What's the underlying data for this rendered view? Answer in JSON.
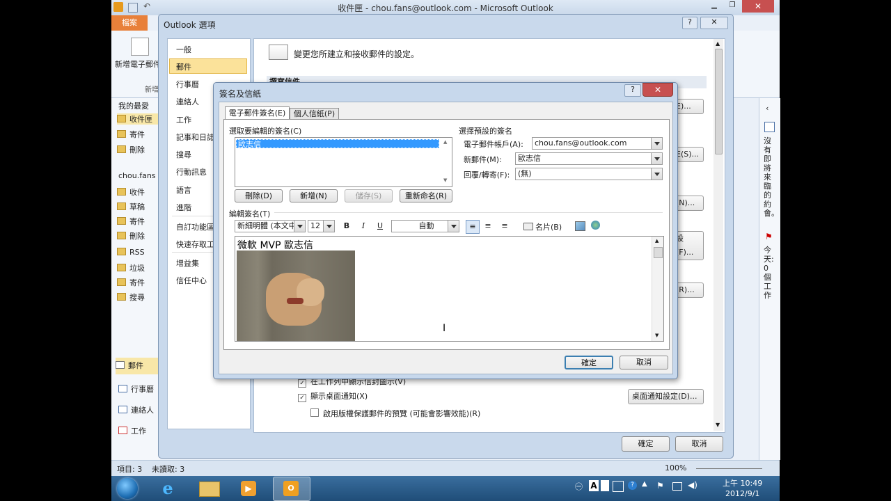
{
  "outlook": {
    "title": "收件匣 - chou.fans@outlook.com - Microsoft Outlook",
    "file_tab": "檔案",
    "new_email": "新增電子郵件",
    "new_group": "新增",
    "nav_favorites": "我的最愛",
    "nav_favorites_items": [
      "收件匣",
      "寄件",
      "刪除"
    ],
    "nav_account": "chou.fans",
    "nav_account_items": [
      "收件",
      "草稿",
      "寄件",
      "刪除",
      "RSS",
      "垃圾",
      "寄件",
      "搜尋"
    ],
    "bottom_nav": [
      "郵件",
      "行事曆",
      "連絡人",
      "工作"
    ],
    "todo_no_appointments": "沒有即將來臨的約會。",
    "todo_tasks": "今天: 0 個工作",
    "status_items": "項目: 3",
    "status_unread": "未讀取: 3",
    "zoom": "100%"
  },
  "options": {
    "title": "Outlook 選項",
    "categories": [
      "一般",
      "郵件",
      "行事曆",
      "連絡人",
      "工作",
      "記事和日誌",
      "搜尋",
      "行動訊息",
      "語言",
      "進階",
      "自訂功能區",
      "快速存取工具列",
      "增益集",
      "信任中心"
    ],
    "selected_index": 1,
    "header_text": "變更您所建立和接收郵件的設定。",
    "section_compose": "撰寫信件",
    "right_buttons": [
      "E)...",
      "E(S)...",
      "(N)...",
      "設(F)...",
      "(R)..."
    ],
    "show_envelope_icon": "在工作列中顯示信封圖示(V)",
    "show_desktop_alert": "顯示桌面通知(X)",
    "desktop_alert_settings": "桌面通知設定(D)...",
    "enable_preview": "啟用版權保護郵件的預覽 (可能會影響效能)(R)",
    "ok": "確定",
    "cancel": "取消"
  },
  "signature": {
    "title": "簽名及信紙",
    "tabs": [
      "電子郵件簽名(E)",
      "個人信紙(P)"
    ],
    "select_label": "選取要編輯的簽名(C)",
    "signatures": [
      "歐志信"
    ],
    "btn_delete": "刪除(D)",
    "btn_new": "新增(N)",
    "btn_save": "儲存(S)",
    "btn_rename": "重新命名(R)",
    "default_label": "選擇預設的簽名",
    "account_label": "電子郵件帳戶(A):",
    "account_value": "chou.fans@outlook.com",
    "new_msg_label": "新郵件(M):",
    "new_msg_value": "歐志信",
    "reply_label": "回覆/轉寄(F):",
    "reply_value": "(無)",
    "edit_label": "編輯簽名(T)",
    "font_value": "新細明體 (本文中",
    "size_value": "12",
    "color_value": "自動",
    "bold": "B",
    "italic": "I",
    "underline": "U",
    "business_card": "名片(B)",
    "signature_text": "微軟 MVP 歐志信",
    "ok": "確定",
    "cancel": "取消"
  },
  "taskbar": {
    "time": "上午 10:49",
    "date": "2012/9/1",
    "ime": "A"
  }
}
